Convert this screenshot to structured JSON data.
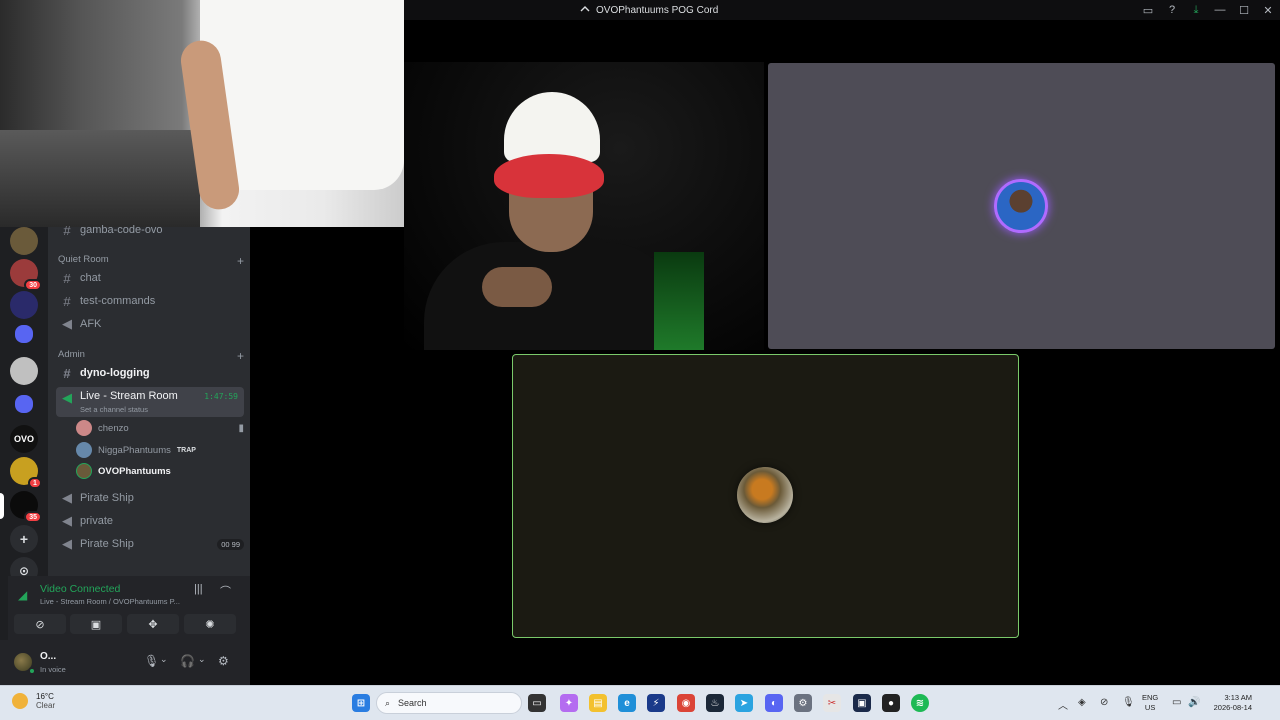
{
  "window": {
    "title": "OVOPhantuums POG Cord"
  },
  "channels": {
    "top_partial": "gamba-code-ovo",
    "categories": [
      {
        "label": "Quiet Room"
      },
      {
        "label": "Admin"
      }
    ],
    "quiet_room": [
      "chat",
      "test-commands",
      "AFK"
    ],
    "admin": {
      "dyno": "dyno-logging",
      "live": "Live - Stream Room",
      "live_timer": "1:47:59",
      "live_status": "Set a channel status",
      "members": [
        {
          "name": "chenzo"
        },
        {
          "name": "NiggaPhantuums",
          "tag": "TRAP"
        },
        {
          "name": "OVOPhantuums"
        }
      ],
      "pirate1": "Pirate Ship",
      "private": "private",
      "pirate2": "Pirate Ship",
      "pirate2_badge": "00 99"
    }
  },
  "servers": {
    "badges": [
      "30",
      "1",
      "35"
    ],
    "labels": [
      "OVO"
    ]
  },
  "voice": {
    "title": "Video Connected",
    "subtitle": "Live - Stream Room / OVOPhantuums P..."
  },
  "user": {
    "name": "O...",
    "status": "In voice"
  },
  "taskbar": {
    "temp": "16°C",
    "condition": "Clear",
    "search": "Search",
    "lang1": "ENG",
    "lang2": "US",
    "time": "3:13 AM",
    "date": "2026-08-14"
  },
  "colors": {
    "accent_green": "#23a55a",
    "speaking_ring": "#7ac96a",
    "avatar_ring": "#b06bff"
  }
}
